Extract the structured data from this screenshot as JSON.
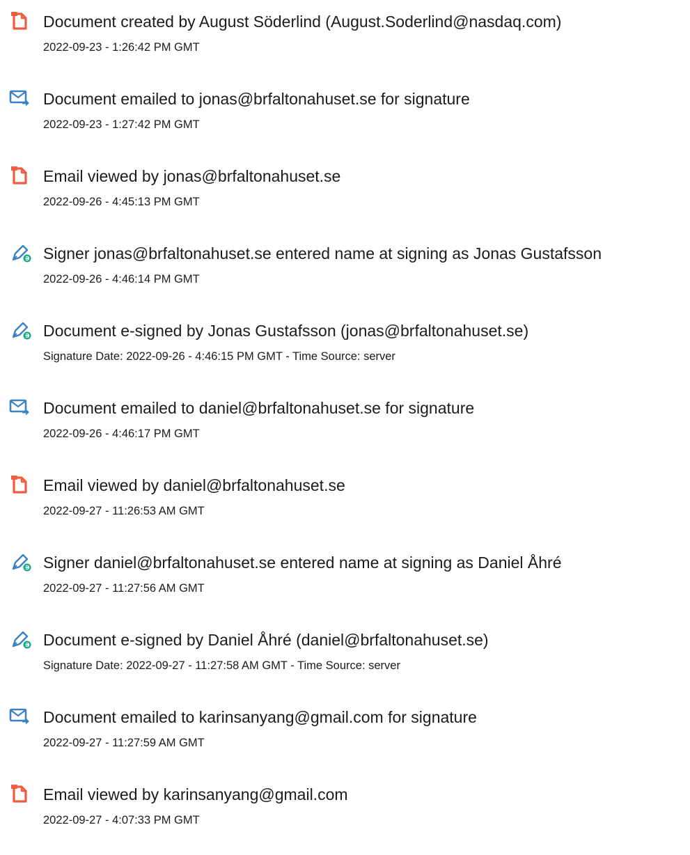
{
  "events": [
    {
      "icon": "document-created-icon",
      "title": "Document created by August Söderlind (August.Soderlind@nasdaq.com)",
      "detail": "2022-09-23 - 1:26:42 PM GMT"
    },
    {
      "icon": "email-sent-icon",
      "title": "Document emailed to jonas@brfaltonahuset.se for signature",
      "detail": "2022-09-23 - 1:27:42 PM GMT"
    },
    {
      "icon": "document-viewed-icon",
      "title": "Email viewed by jonas@brfaltonahuset.se",
      "detail": "2022-09-26 - 4:45:13 PM GMT"
    },
    {
      "icon": "e-sign-pen-icon",
      "title": "Signer jonas@brfaltonahuset.se entered name at signing as Jonas Gustafsson",
      "detail": "2022-09-26 - 4:46:14 PM GMT"
    },
    {
      "icon": "e-sign-pen-icon",
      "title": "Document e-signed by Jonas Gustafsson (jonas@brfaltonahuset.se)",
      "detail": "Signature Date: 2022-09-26 - 4:46:15 PM GMT - Time Source: server"
    },
    {
      "icon": "email-sent-icon",
      "title": "Document emailed to daniel@brfaltonahuset.se for signature",
      "detail": "2022-09-26 - 4:46:17 PM GMT"
    },
    {
      "icon": "document-viewed-icon",
      "title": "Email viewed by daniel@brfaltonahuset.se",
      "detail": "2022-09-27 - 11:26:53 AM GMT"
    },
    {
      "icon": "e-sign-pen-icon",
      "title": "Signer daniel@brfaltonahuset.se entered name at signing as Daniel Åhré",
      "detail": "2022-09-27 - 11:27:56 AM GMT"
    },
    {
      "icon": "e-sign-pen-icon",
      "title": "Document e-signed by Daniel Åhré (daniel@brfaltonahuset.se)",
      "detail": "Signature Date: 2022-09-27 - 11:27:58 AM GMT - Time Source: server"
    },
    {
      "icon": "email-sent-icon",
      "title": "Document emailed to karinsanyang@gmail.com for signature",
      "detail": "2022-09-27 - 11:27:59 AM GMT"
    },
    {
      "icon": "document-viewed-icon",
      "title": "Email viewed by karinsanyang@gmail.com",
      "detail": "2022-09-27 - 4:07:33 PM GMT"
    }
  ],
  "colors": {
    "document_icon": "#f15b40",
    "email_icon": "#3b82c4",
    "sign_icon": "#14a889",
    "text": "#1c1c1c"
  }
}
